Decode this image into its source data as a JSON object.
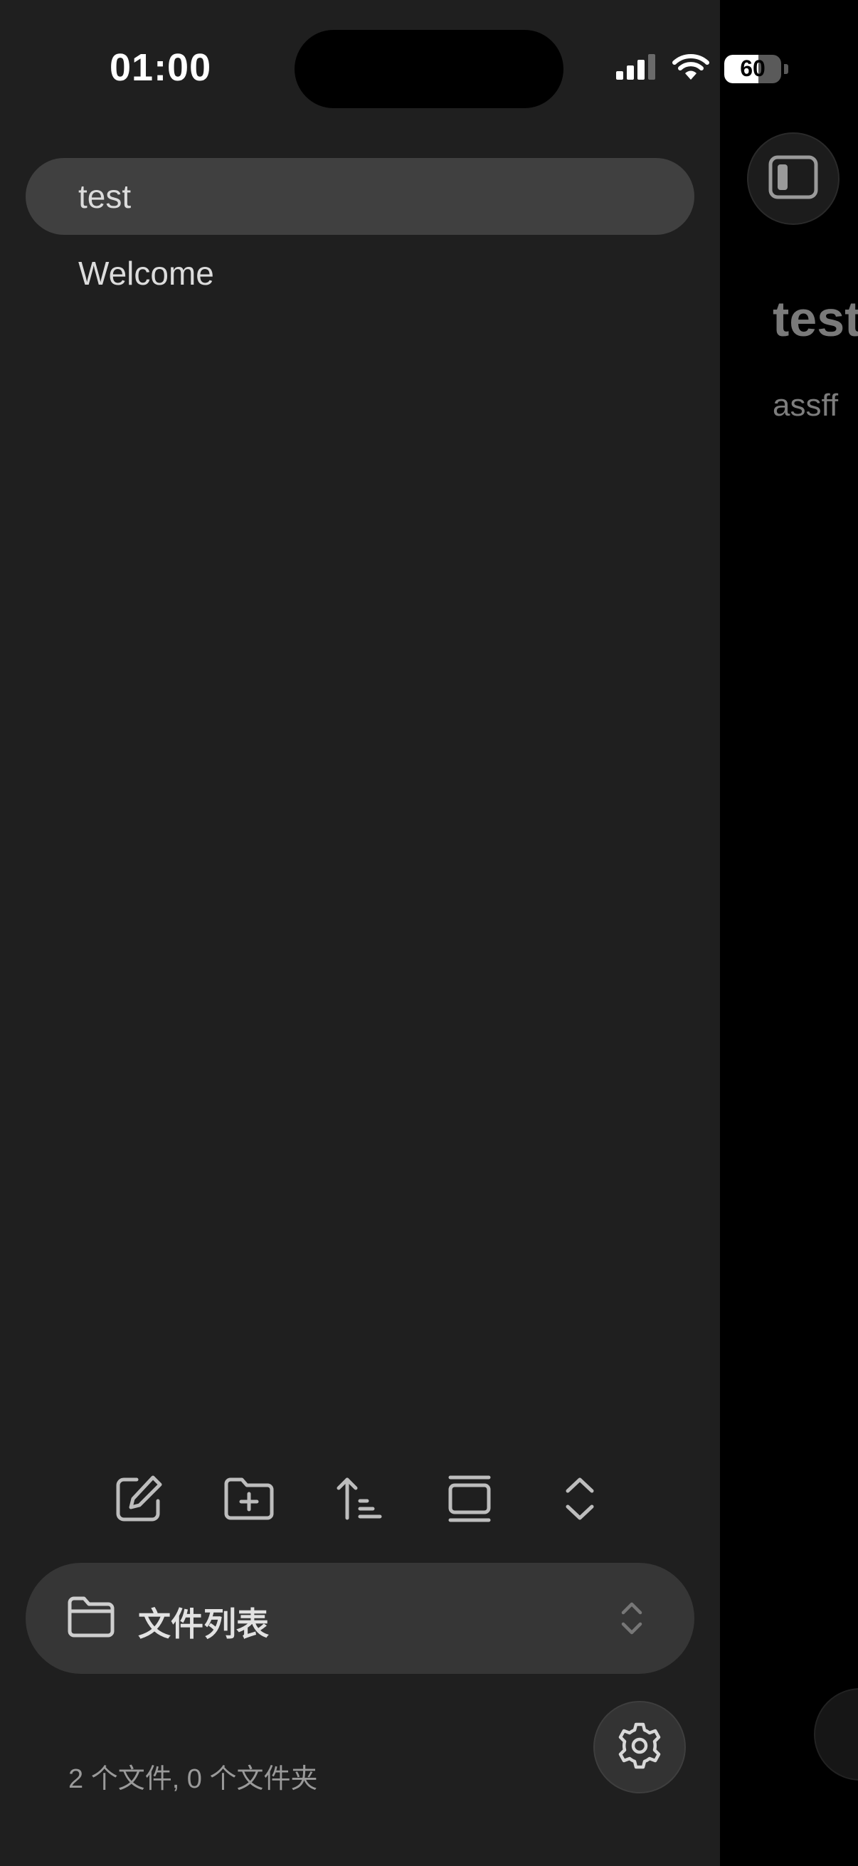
{
  "status_bar": {
    "time": "01:00",
    "battery_level": "60",
    "battery_fraction": 0.6,
    "icons": [
      "signal-icon",
      "wifi-icon",
      "battery-icon"
    ]
  },
  "file_list": {
    "items": [
      {
        "label": "test",
        "selected": true
      },
      {
        "label": "Welcome",
        "selected": false
      }
    ]
  },
  "toolbar": {
    "buttons": [
      {
        "icon": "new-note-icon"
      },
      {
        "icon": "new-folder-icon"
      },
      {
        "icon": "sort-icon"
      },
      {
        "icon": "view-mode-icon"
      },
      {
        "icon": "expand-collapse-icon"
      }
    ]
  },
  "vault": {
    "label": "文件列表",
    "icon": "folder-icon"
  },
  "footer": {
    "count_text": "2 个文件, 0 个文件夹"
  },
  "settings": {
    "icon": "gear-icon"
  },
  "content": {
    "title": "test",
    "body": "assff"
  },
  "colors": {
    "sidebar_bg": "#1f1f1f",
    "selected_item_bg": "#404040",
    "vault_bg": "#363636",
    "content_bg": "#000000"
  }
}
